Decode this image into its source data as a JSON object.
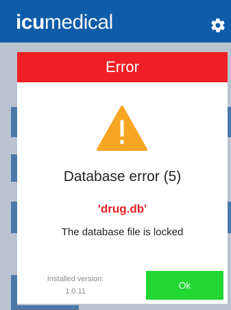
{
  "header": {
    "brand_bold": "icu",
    "brand_light": "medical",
    "settings_icon": "gear-icon",
    "color": "#0f5ca8"
  },
  "dialog": {
    "title": "Error",
    "title_bg": "#ee2025",
    "icon": "warning-icon",
    "icon_color": "#f6a623",
    "heading": "Database error (5)",
    "file": "'drug.db'",
    "file_color": "#e52125",
    "message": "The database file is locked",
    "installed_label": "Installed version:",
    "installed_version": "1.0.11",
    "ok_label": "Ok",
    "ok_color": "#22d633"
  }
}
